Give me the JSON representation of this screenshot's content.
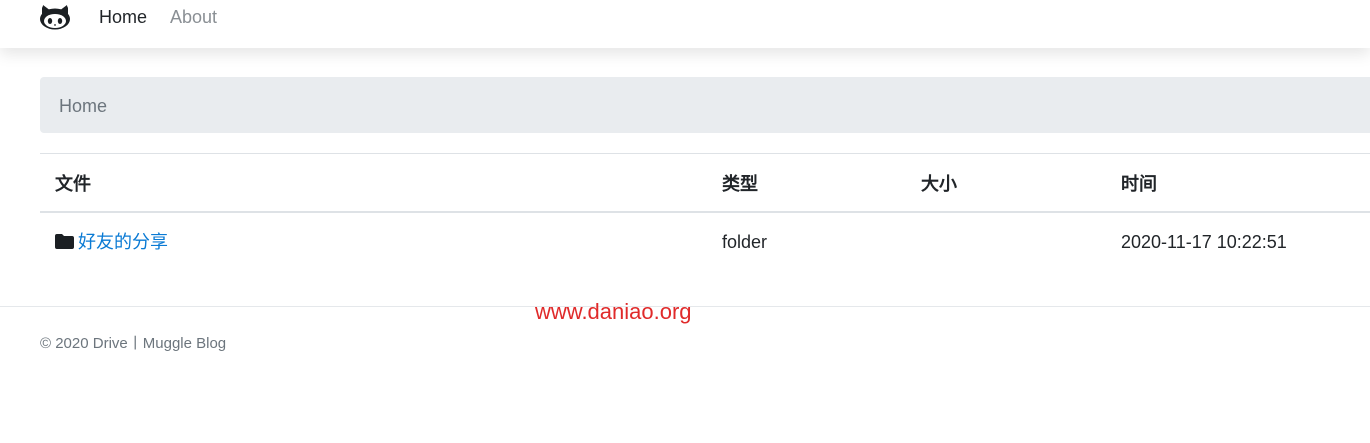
{
  "navbar": {
    "logo_icon": "github-octocat-icon",
    "links": [
      {
        "label": "Home",
        "active": true
      },
      {
        "label": "About",
        "active": false
      }
    ]
  },
  "breadcrumb": {
    "items": [
      "Home"
    ]
  },
  "table": {
    "headers": {
      "file": "文件",
      "type": "类型",
      "size": "大小",
      "time": "时间"
    },
    "rows": [
      {
        "icon": "folder-icon",
        "name": "好友的分享",
        "type": "folder",
        "size": "",
        "time": "2020-11-17 10:22:51"
      }
    ]
  },
  "watermark": "www.daniao.org",
  "footer": {
    "text": "© 2020 Drive丨Muggle Blog"
  },
  "colors": {
    "link": "#0a7ad4",
    "breadcrumb_bg": "#e9ecef",
    "watermark": "#e02a2a",
    "muted": "#6c757d"
  }
}
